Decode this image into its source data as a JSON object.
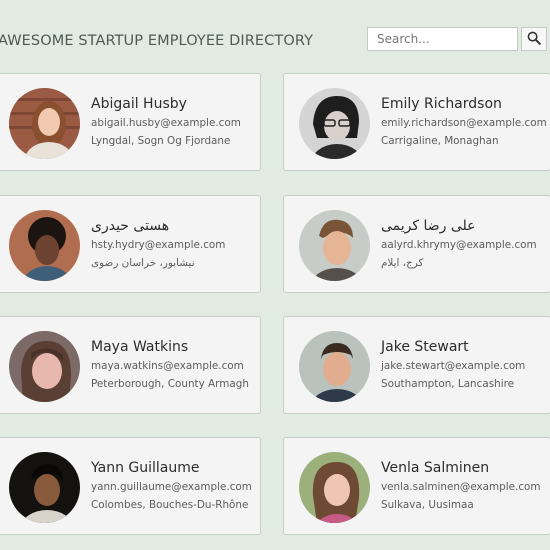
{
  "header": {
    "title": "AWESOME STARTUP EMPLOYEE DIRECTORY",
    "search_placeholder": "Search...",
    "search_value": "",
    "search_icon": "search-icon"
  },
  "employees": [
    {
      "name": "Abigail Husby",
      "email": "abigail.husby@example.com",
      "location": "Lyngdal, Sogn Og Fjordane"
    },
    {
      "name": "Emily Richardson",
      "email": "emily.richardson@example.com",
      "location": "Carrigaline, Monaghan"
    },
    {
      "name": "هستی حیدری",
      "email": "hsty.hydry@example.com",
      "location": "نیشابور، خراسان رضوی"
    },
    {
      "name": "علی رضا کریمی",
      "email": "aalyrd.khrymy@example.com",
      "location": "کرج، ایلام"
    },
    {
      "name": "Maya Watkins",
      "email": "maya.watkins@example.com",
      "location": "Peterborough, County Armagh"
    },
    {
      "name": "Jake Stewart",
      "email": "jake.stewart@example.com",
      "location": "Southampton, Lancashire"
    },
    {
      "name": "Yann Guillaume",
      "email": "yann.guillaume@example.com",
      "location": "Colombes, Bouches-Du-Rhône"
    },
    {
      "name": "Venla Salminen",
      "email": "venla.salminen@example.com",
      "location": "Sulkava, Uusimaa"
    }
  ],
  "colors": {
    "background": "#e2ebe1",
    "card": "#f5f4f5",
    "card_border": "#c9cdc9",
    "title": "#4e5a56"
  }
}
